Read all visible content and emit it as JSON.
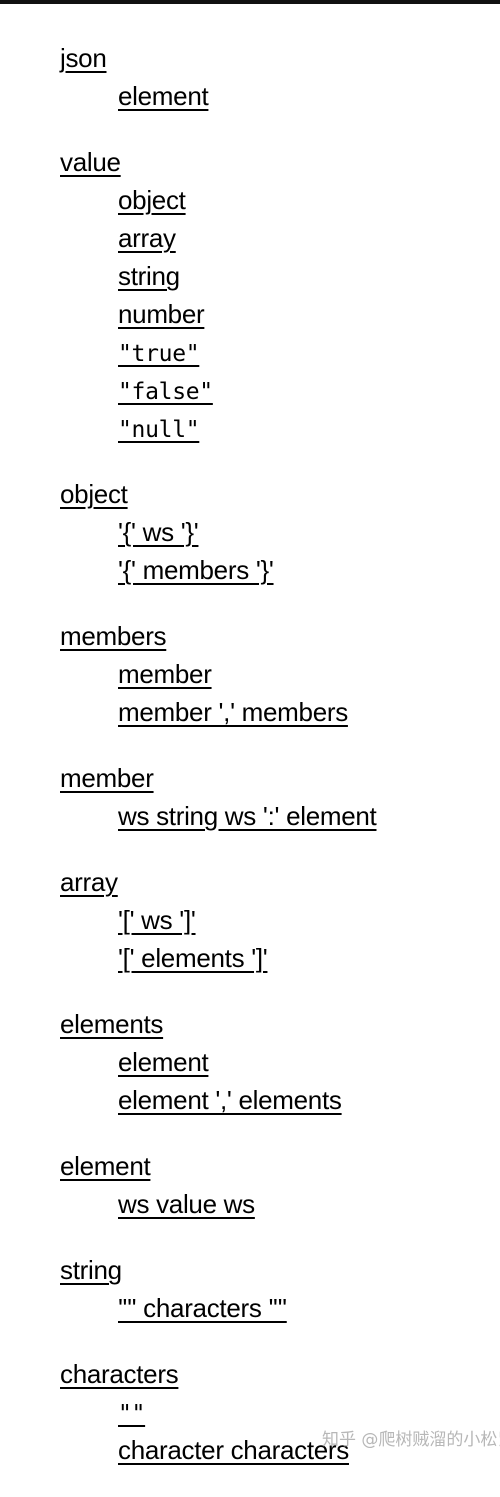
{
  "rules": [
    {
      "name": "json",
      "alternatives": [
        "element"
      ]
    },
    {
      "name": "value",
      "alternatives": [
        "object",
        "array",
        "string",
        "number",
        "\"true\"",
        "\"false\"",
        "\"null\""
      ]
    },
    {
      "name": "object",
      "alternatives": [
        "'{' ws '}'",
        "'{' members '}'"
      ]
    },
    {
      "name": "members",
      "alternatives": [
        "member",
        "member ',' members"
      ]
    },
    {
      "name": "member",
      "alternatives": [
        "ws string ws ':' element"
      ]
    },
    {
      "name": "array",
      "alternatives": [
        "'[' ws ']'",
        "'[' elements ']'"
      ]
    },
    {
      "name": "elements",
      "alternatives": [
        "element",
        "element ',' elements"
      ]
    },
    {
      "name": "element",
      "alternatives": [
        "ws value ws"
      ]
    },
    {
      "name": "string",
      "alternatives": [
        "'\"' characters '\"'"
      ]
    },
    {
      "name": "characters",
      "alternatives": [
        "\"\"",
        "character characters"
      ]
    }
  ],
  "watermark": "知乎 @爬树贼溜的小松鼠"
}
